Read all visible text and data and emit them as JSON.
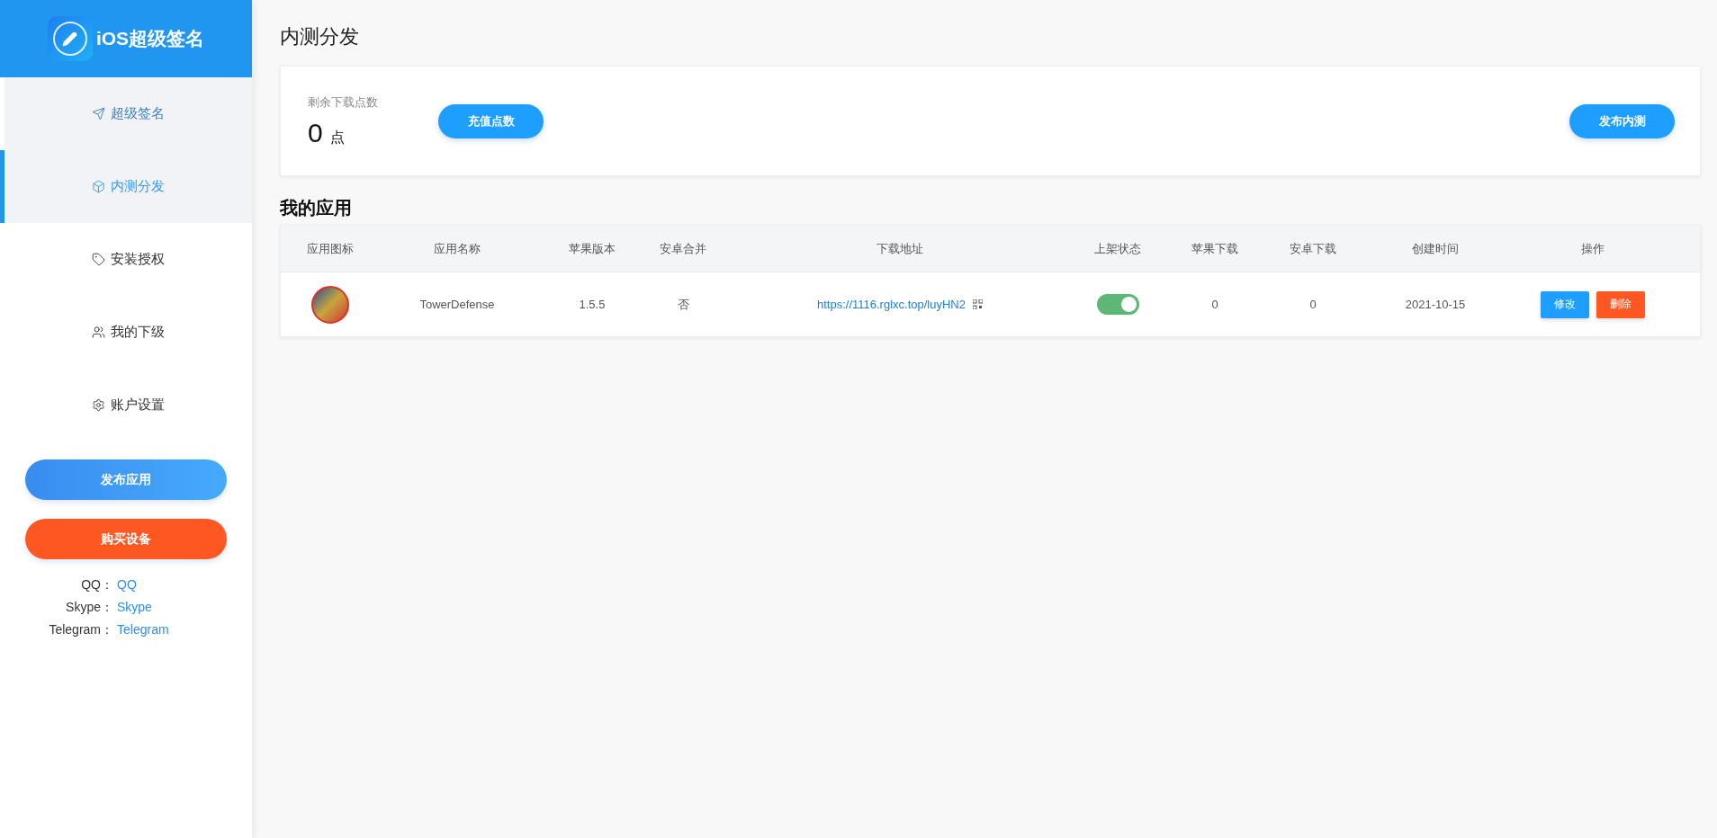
{
  "brand": {
    "title": "iOS超级签名"
  },
  "nav": [
    {
      "label": "超级签名",
      "kind": "send",
      "highlighted": true,
      "selected": false
    },
    {
      "label": "内测分发",
      "kind": "box",
      "highlighted": true,
      "selected": true
    },
    {
      "label": "安装授权",
      "kind": "tag",
      "highlighted": false,
      "selected": false
    },
    {
      "label": "我的下级",
      "kind": "users",
      "highlighted": false,
      "selected": false
    },
    {
      "label": "账户设置",
      "kind": "settings",
      "highlighted": false,
      "selected": false
    }
  ],
  "side_buttons": [
    {
      "label": "发布应用",
      "kind": "primary"
    },
    {
      "label": "购买设备",
      "kind": "danger"
    }
  ],
  "contacts": [
    {
      "label": "QQ：",
      "value": "QQ"
    },
    {
      "label": "Skype：",
      "value": "Skype"
    },
    {
      "label": "Telegram：",
      "value": "Telegram"
    }
  ],
  "page_title": "内测分发",
  "balance": {
    "label": "剩余下载点数",
    "value": "0",
    "unit": "点",
    "recharge_button": "充值点数",
    "publish_button": "发布内测"
  },
  "section_title": "我的应用",
  "table": {
    "columns": [
      "应用图标",
      "应用名称",
      "苹果版本",
      "安卓合并",
      "下载地址",
      "上架状态",
      "苹果下载",
      "安卓下载",
      "创建时间",
      "操作"
    ],
    "rows": [
      {
        "name": "TowerDefense",
        "ios_version": "1.5.5",
        "android_merge": "否",
        "url": "https://1116.rglxc.top/luyHN2",
        "listed": true,
        "ios_downloads": "0",
        "android_downloads": "0",
        "created": "2021-10-15",
        "edit": "修改",
        "delete": "删除"
      }
    ]
  }
}
